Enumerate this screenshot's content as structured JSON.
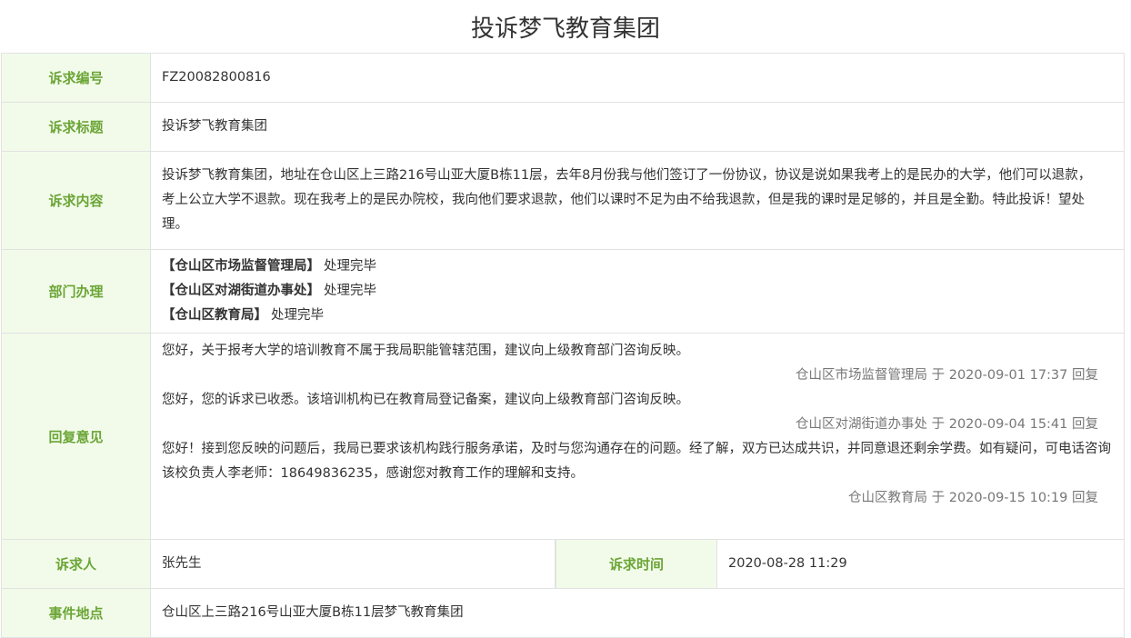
{
  "title": "投诉梦飞教育集团",
  "rows": {
    "id": {
      "label": "诉求编号",
      "value": "FZ20082800816"
    },
    "subject": {
      "label": "诉求标题",
      "value": "投诉梦飞教育集团"
    },
    "content": {
      "label": "诉求内容",
      "value": "投诉梦飞教育集团，地址在仓山区上三路216号山亚大厦B栋11层，去年8月份我与他们签订了一份协议，协议是说如果我考上的是民办的大学，他们可以退款，考上公立大学不退款。现在我考上的是民办院校，我向他们要求退款，他们以课时不足为由不给我退款，但是我的课时是足够的，并且是全勤。特此投诉！望处理。"
    },
    "departments": {
      "label": "部门办理",
      "items": [
        {
          "name": "【仓山区市场监督管理局】",
          "status": "处理完毕"
        },
        {
          "name": "【仓山区对湖街道办事处】",
          "status": "处理完毕"
        },
        {
          "name": "【仓山区教育局】",
          "status": "处理完毕"
        }
      ]
    },
    "replies": {
      "label": "回复意见",
      "items": [
        {
          "text": "您好，关于报考大学的培训教育不属于我局职能管辖范围，建议向上级教育部门咨询反映。",
          "signature": "仓山区市场监督管理局 于 2020-09-01 17:37 回复"
        },
        {
          "text": "您好，您的诉求已收悉。该培训机构已在教育局登记备案，建议向上级教育部门咨询反映。",
          "signature": "仓山区对湖街道办事处 于 2020-09-04 15:41 回复"
        },
        {
          "text": "您好！接到您反映的问题后，我局已要求该机构践行服务承诺，及时与您沟通存在的问题。经了解，双方已达成共识，并同意退还剩余学费。如有疑问，可电话咨询该校负责人李老师：18649836235，感谢您对教育工作的理解和支持。",
          "signature": "仓山区教育局 于 2020-09-15 10:19 回复"
        }
      ]
    },
    "person": {
      "label": "诉求人",
      "value": "张先生"
    },
    "time": {
      "label": "诉求时间",
      "value": "2020-08-28 11:29"
    },
    "location": {
      "label": "事件地点",
      "value": "仓山区上三路216号山亚大厦B栋11层梦飞教育集团"
    }
  }
}
